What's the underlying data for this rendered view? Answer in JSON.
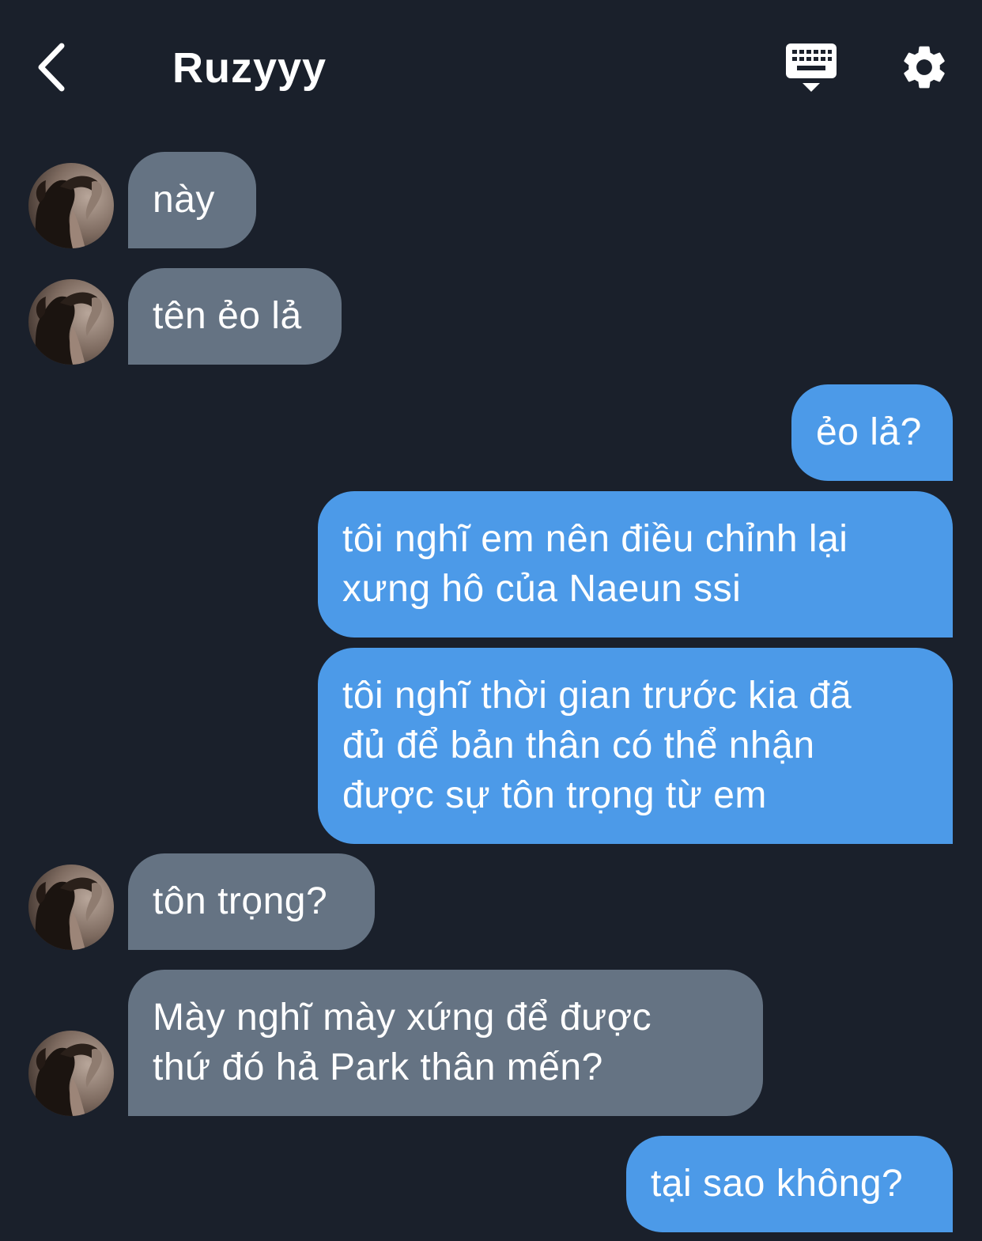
{
  "header": {
    "title": "Ruzyyy"
  },
  "colors": {
    "background": "#1a202b",
    "incoming_bubble": "#657383",
    "outgoing_bubble": "#4c9ae8",
    "text": "#ffffff"
  },
  "icons": {
    "back": "chevron-left-icon",
    "keyboard": "keyboard-hide-icon",
    "settings": "gear-icon"
  },
  "messages": [
    {
      "direction": "incoming",
      "text": "này"
    },
    {
      "direction": "incoming",
      "text": "tên ẻo lả"
    },
    {
      "direction": "outgoing",
      "text": "ẻo lả?"
    },
    {
      "direction": "outgoing",
      "lines": [
        "tôi nghĩ em nên điều chỉnh lại",
        "xưng hô của Naeun ssi"
      ]
    },
    {
      "direction": "outgoing",
      "lines": [
        "tôi nghĩ thời gian trước kia đã",
        "đủ để bản thân có thể nhận",
        "được sự tôn trọng từ em"
      ]
    },
    {
      "direction": "incoming",
      "text": "tôn trọng?"
    },
    {
      "direction": "incoming",
      "lines": [
        "Mày nghĩ mày xứng để được",
        "thứ đó hả Park thân mến?"
      ]
    },
    {
      "direction": "outgoing",
      "text": "tại sao không?"
    }
  ]
}
